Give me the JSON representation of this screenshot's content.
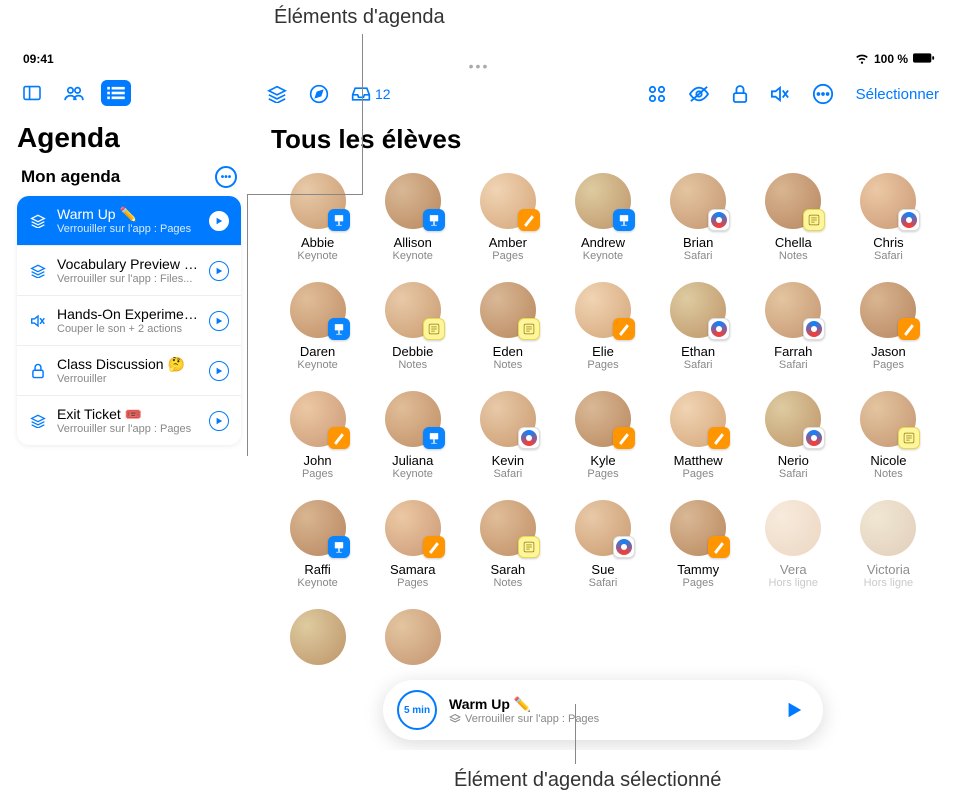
{
  "annotations": {
    "top": "Éléments d'agenda",
    "bottom": "Élément d'agenda sélectionné"
  },
  "statusbar": {
    "time": "09:41",
    "battery": "100 %"
  },
  "sidebar": {
    "title": "Agenda",
    "subtitle": "Mon agenda",
    "items": [
      {
        "title": "Warm Up ✏️",
        "sub": "Verrouiller sur l'app : Pages",
        "selected": true,
        "icon": "stack"
      },
      {
        "title": "Vocabulary Preview 💡",
        "sub": "Verrouiller sur l'app : Files...",
        "selected": false,
        "icon": "stack"
      },
      {
        "title": "Hands-On Experiment 🧪",
        "sub": "Couper le son + 2 actions",
        "selected": false,
        "icon": "mute"
      },
      {
        "title": "Class Discussion 🤔",
        "sub": "Verrouiller",
        "selected": false,
        "icon": "lock"
      },
      {
        "title": "Exit Ticket 🎟️",
        "sub": "Verrouiller sur l'app : Pages",
        "selected": false,
        "icon": "stack"
      }
    ]
  },
  "topbar": {
    "inbox_count": "12",
    "select_label": "Sélectionner"
  },
  "main": {
    "title": "Tous les élèves",
    "students": [
      {
        "name": "Abbie",
        "app": "Keynote",
        "badge": "keynote"
      },
      {
        "name": "Allison",
        "app": "Keynote",
        "badge": "keynote"
      },
      {
        "name": "Amber",
        "app": "Pages",
        "badge": "pages"
      },
      {
        "name": "Andrew",
        "app": "Keynote",
        "badge": "keynote"
      },
      {
        "name": "Brian",
        "app": "Safari",
        "badge": "safari"
      },
      {
        "name": "Chella",
        "app": "Notes",
        "badge": "notes"
      },
      {
        "name": "Chris",
        "app": "Safari",
        "badge": "safari"
      },
      {
        "name": "Daren",
        "app": "Keynote",
        "badge": "keynote"
      },
      {
        "name": "Debbie",
        "app": "Notes",
        "badge": "notes"
      },
      {
        "name": "Eden",
        "app": "Notes",
        "badge": "notes"
      },
      {
        "name": "Elie",
        "app": "Pages",
        "badge": "pages"
      },
      {
        "name": "Ethan",
        "app": "Safari",
        "badge": "safari"
      },
      {
        "name": "Farrah",
        "app": "Safari",
        "badge": "safari"
      },
      {
        "name": "Jason",
        "app": "Pages",
        "badge": "pages"
      },
      {
        "name": "John",
        "app": "Pages",
        "badge": "pages"
      },
      {
        "name": "Juliana",
        "app": "Keynote",
        "badge": "keynote"
      },
      {
        "name": "Kevin",
        "app": "Safari",
        "badge": "safari"
      },
      {
        "name": "Kyle",
        "app": "Pages",
        "badge": "pages"
      },
      {
        "name": "Matthew",
        "app": "Pages",
        "badge": "pages"
      },
      {
        "name": "Nerio",
        "app": "Safari",
        "badge": "safari"
      },
      {
        "name": "Nicole",
        "app": "Notes",
        "badge": "notes"
      },
      {
        "name": "Raffi",
        "app": "Keynote",
        "badge": "keynote"
      },
      {
        "name": "Samara",
        "app": "Pages",
        "badge": "pages"
      },
      {
        "name": "Sarah",
        "app": "Notes",
        "badge": "notes"
      },
      {
        "name": "Sue",
        "app": "Safari",
        "badge": "safari"
      },
      {
        "name": "Tammy",
        "app": "Pages",
        "badge": "pages"
      },
      {
        "name": "Vera",
        "app": "Hors ligne",
        "badge": "",
        "dim": true
      },
      {
        "name": "Victoria",
        "app": "Hors ligne",
        "badge": "",
        "dim": true
      }
    ],
    "extra_row_count": 2
  },
  "pill": {
    "timer": "5 min",
    "title": "Warm Up ✏️",
    "sub": "Verrouiller sur l'app : Pages"
  }
}
